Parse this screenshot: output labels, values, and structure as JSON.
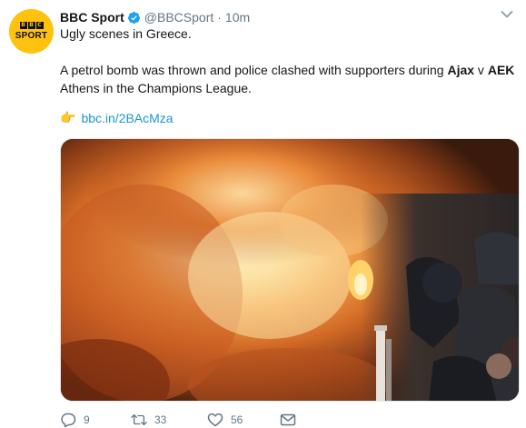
{
  "account": {
    "name": "BBC Sport",
    "handle": "@BBCSport",
    "separator": "·",
    "time": "10m",
    "avatar_blocks": [
      "B",
      "B",
      "C"
    ],
    "avatar_word": "SPORT",
    "avatar_color": "#ffc20e"
  },
  "tweet": {
    "line1": "Ugly scenes in Greece.",
    "line2_prefix": "A petrol bomb was thrown and police clashed with supporters during ",
    "team1": "Ajax",
    "line2_mid": " v ",
    "team2": "AEK",
    "line3": "Athens in the Champions League.",
    "link_emoji": "👉",
    "link_text": "bbc.in/2BAcMza"
  },
  "media": {
    "description_icon": "photo-fire-stadium"
  },
  "actions": {
    "replies": "9",
    "retweets": "33",
    "likes": "56"
  },
  "colors": {
    "link": "#1b95e0",
    "muted": "#657786",
    "verified": "#1da1f2"
  }
}
